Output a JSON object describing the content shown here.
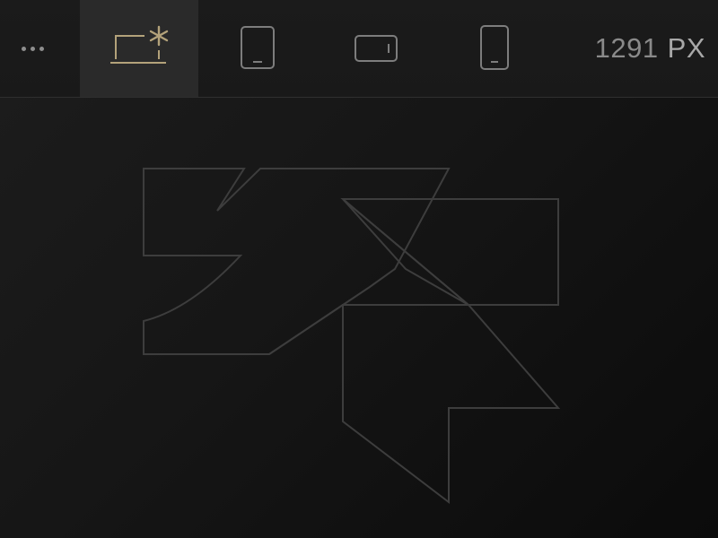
{
  "toolbar": {
    "more_icon": "more-horizontal-icon",
    "devices": [
      {
        "name": "desktop",
        "icon": "laptop-icon",
        "active": true
      },
      {
        "name": "tablet",
        "icon": "tablet-portrait-icon",
        "active": false
      },
      {
        "name": "tablet-landscape",
        "icon": "phone-landscape-icon",
        "active": false
      },
      {
        "name": "mobile",
        "icon": "phone-portrait-icon",
        "active": false
      }
    ],
    "viewport_width": "1291",
    "viewport_unit": "PX"
  },
  "colors": {
    "accent": "#b3a27a",
    "icon_idle": "#7d7d7d",
    "active_bg": "#2a2a2a",
    "background": "#161616",
    "logo_stroke": "#3a3a3a"
  },
  "canvas": {
    "logo_icon": "brand-logo-mark-icon"
  }
}
